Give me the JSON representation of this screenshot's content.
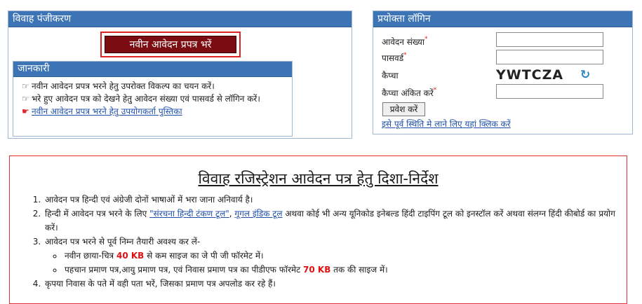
{
  "registration": {
    "title": "विवाह पंजीकरण",
    "new_form_button": "नवीन आवेदन प्रपत्र भरें",
    "info": {
      "title": "जानकारी",
      "items": [
        "नवीन आवेदन प्रपत्र भरने हेतु उपरोक्त विकल्प का चयन करें।",
        "भरे हुए आवेदन पत्र को देखने हेतु आवेदन संख्या एवं पासवर्ड से लॉगिन करें।"
      ],
      "manual_link": "नवीन आवेदन प्रपत्र भरने हेतु उपयोगकर्ता पुस्तिका"
    }
  },
  "login": {
    "title": "प्रयोक्ता लॉगिन",
    "application_no_label": "आवेदन संख्या",
    "password_label": "पासवर्ड",
    "captcha_label": "कैप्चा",
    "captcha_text": "YWTCZA",
    "captcha_entry_label": "कैप्चा अंकित करें",
    "required_mark": "*",
    "submit_button": "प्रवेश करें",
    "restore_link": "इसे पूर्व स्थिति मे लाने लिए यहां क्लिक करें"
  },
  "guidelines": {
    "title": "विवाह रजिस्ट्रेशन आवेदन पत्र हेतु दिशा-निर्देश",
    "item1": "आवेदन पत्र हिन्दी एवं अंग्रेजी दोनों भाषाओं में भरा जाना अनिवार्य है।",
    "item2_pre": "हिन्दी में आवेदन पत्र भरने के लिए ",
    "item2_link1": "\"संरचना हिन्दी टंकण टूल\"",
    "item2_sep": ", ",
    "item2_link2": "गूगल इंडिक टूल",
    "item2_post": " अथवा कोई भी अन्य यूनिकोड इनेबल्ड हिंदी टाइपिंग टूल को इनस्टॉल करें अथवा संलग्न हिंदी कीबोर्ड का प्रयोग करें।",
    "item3": "आवेदन पत्र भरने से पूर्व निम्न तैयारी अवश्य कर लें-",
    "sub1_pre": "नवीन छाया-चित्र ",
    "sub1_kb": "40 KB",
    "sub1_post": " से कम साइज का जे पी जी फॉरमेट में।",
    "sub2_pre": "पहचान प्रमाण पत्र,आयु प्रमाण पत्र, एवं निवास प्रमाण पत्र का पीडीएफ फॉरमेट ",
    "sub2_kb": "70 KB",
    "sub2_post": " तक की साइज में।",
    "item4": "कृपया निवास के पते में वही पता भरें, जिसका प्रमाण पत्र अपलोड कर रहे हैं।"
  }
}
